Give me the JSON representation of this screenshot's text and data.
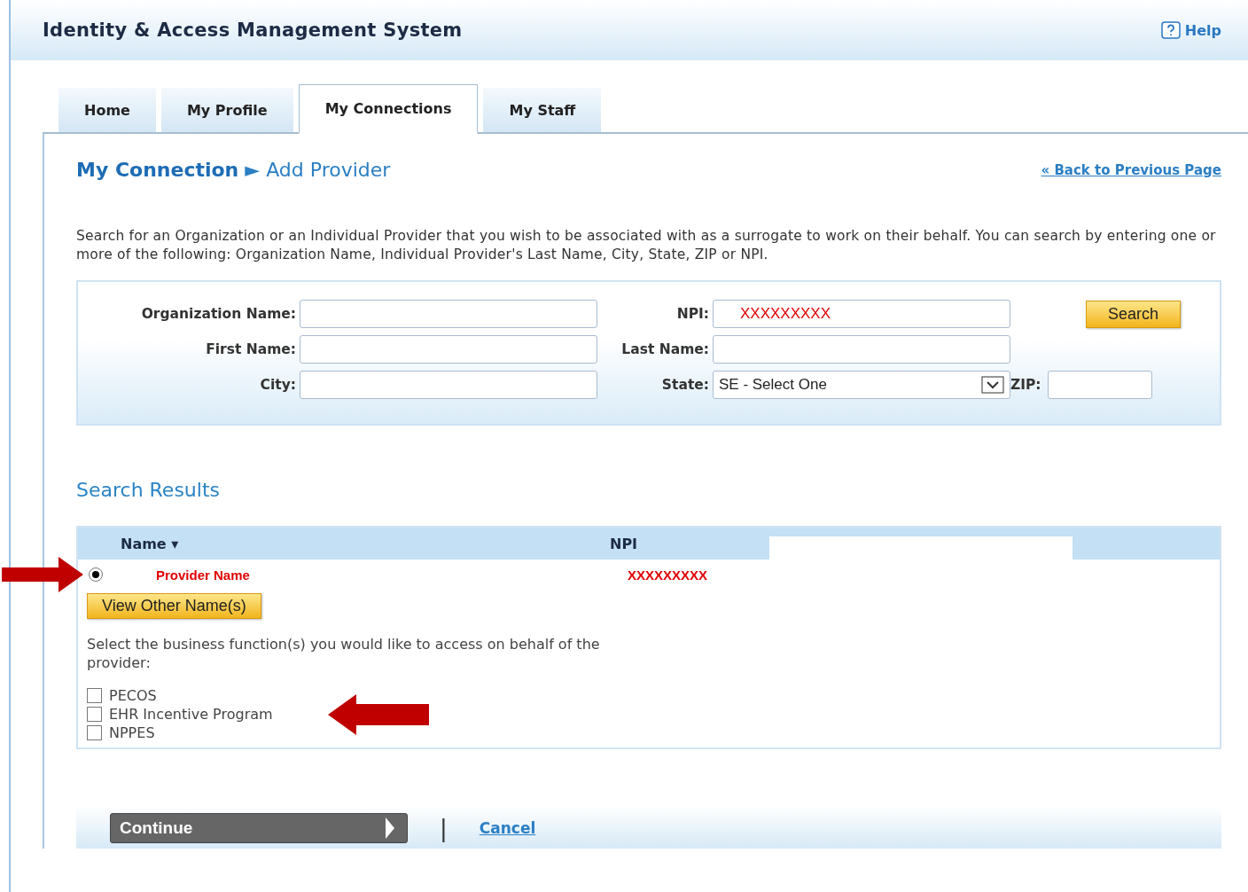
{
  "header": {
    "title": "Identity & Access Management System",
    "help": "Help"
  },
  "tabs": [
    {
      "label": "Home",
      "selected": false
    },
    {
      "label": "My Profile",
      "selected": false
    },
    {
      "label": "My Connections",
      "selected": true
    },
    {
      "label": "My Staff",
      "selected": false
    }
  ],
  "breadcrumb": {
    "parent": "My Connection",
    "separator": "►",
    "current": "Add Provider"
  },
  "back_link": "« Back to Previous Page",
  "intro": "Search for an Organization or an Individual Provider that you wish to be associated with as a surrogate to work on their behalf. You can search by entering one or more of the following: Organization Name, Individual Provider's Last Name, City, State, ZIP or NPI.",
  "search_form": {
    "organization_name": {
      "label": "Organization Name:"
    },
    "npi": {
      "label": "NPI:",
      "value": "XXXXXXXXX"
    },
    "search_button": "Search",
    "first_name": {
      "label": "First Name:"
    },
    "last_name": {
      "label": "Last Name:"
    },
    "city": {
      "label": "City:"
    },
    "state": {
      "label": "State:",
      "value": "SE - Select One"
    },
    "zip": {
      "label": "ZIP:"
    }
  },
  "results": {
    "title": "Search Results",
    "columns": [
      "Name ▾",
      "NPI"
    ],
    "rows": [
      {
        "selected": true,
        "name": "Provider Name",
        "npi": "XXXXXXXXX"
      }
    ],
    "view_other_names": "View Other Name(s)",
    "prompt": "Select the business function(s) you would like to access on behalf of the provider:",
    "functions": [
      {
        "label": "PECOS",
        "checked": false
      },
      {
        "label": "EHR Incentive Program",
        "checked": false
      },
      {
        "label": "NPPES",
        "checked": false
      }
    ]
  },
  "footer": {
    "continue": "Continue",
    "separator": "|",
    "cancel": "Cancel"
  }
}
